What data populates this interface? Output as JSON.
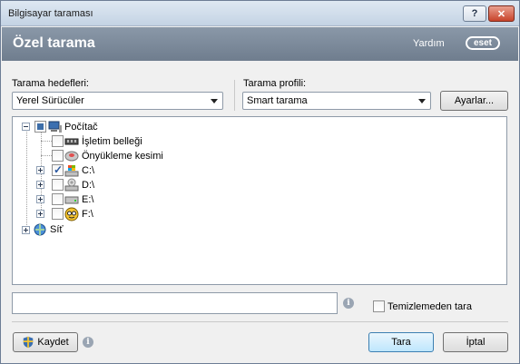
{
  "window": {
    "title": "Bilgisayar taraması",
    "help_glyph": "?",
    "close_glyph": "✕"
  },
  "header": {
    "title": "Özel tarama",
    "help_link": "Yardım",
    "logo_text": "eset"
  },
  "targets": {
    "label": "Tarama hedefleri:",
    "selected": "Yerel Sürücüler"
  },
  "profile": {
    "label": "Tarama profili:",
    "selected": "Smart tarama",
    "settings_button": "Ayarlar..."
  },
  "tree": {
    "root": "Počítač",
    "items": [
      {
        "label": "İşletim belleği",
        "state": "unchecked"
      },
      {
        "label": "Önyükleme kesimi",
        "state": "unchecked"
      },
      {
        "label": "C:\\",
        "state": "checked"
      },
      {
        "label": "D:\\",
        "state": "unchecked"
      },
      {
        "label": "E:\\",
        "state": "unchecked"
      },
      {
        "label": "F:\\",
        "state": "unchecked"
      }
    ],
    "network": "Síť"
  },
  "path_input": {
    "value": ""
  },
  "options": {
    "clean_label": "Temizlemeden tara",
    "clean_checked": false
  },
  "footer": {
    "save_button": "Kaydet",
    "scan_button": "Tara",
    "cancel_button": "İptal"
  },
  "colors": {
    "header_bg": "#7b8899",
    "accent": "#3d6ea8"
  }
}
